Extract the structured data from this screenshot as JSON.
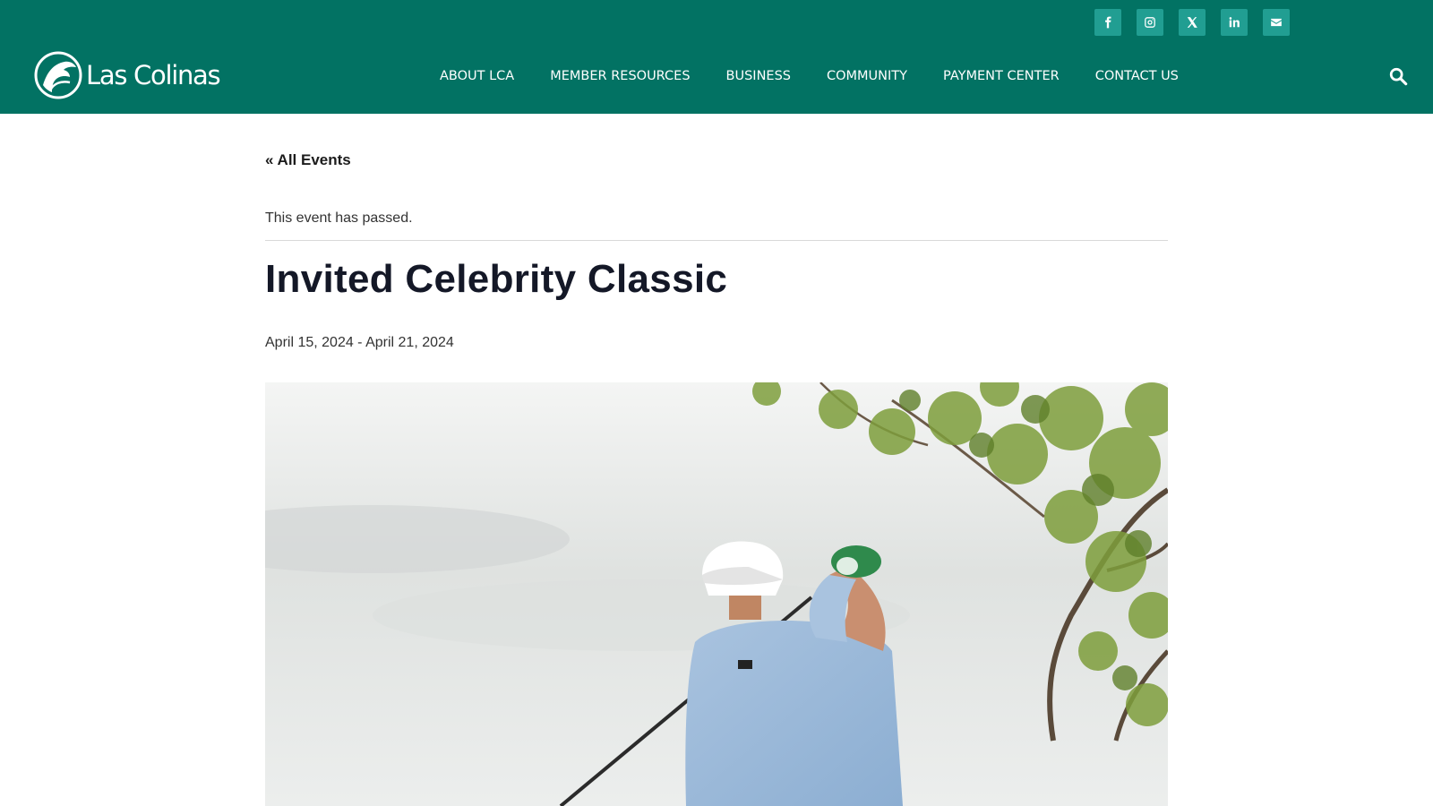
{
  "brand": {
    "name": "Las Colinas",
    "logo_icon": "horse-head-logo-icon"
  },
  "social": [
    {
      "icon": "facebook-icon",
      "label": "f"
    },
    {
      "icon": "instagram-icon",
      "label": ""
    },
    {
      "icon": "x-twitter-icon",
      "label": ""
    },
    {
      "icon": "linkedin-icon",
      "label": "in"
    },
    {
      "icon": "envelope-icon",
      "label": ""
    }
  ],
  "nav": {
    "items": [
      {
        "label": "ABOUT LCA"
      },
      {
        "label": "MEMBER RESOURCES"
      },
      {
        "label": "BUSINESS"
      },
      {
        "label": "COMMUNITY"
      },
      {
        "label": "PAYMENT CENTER"
      },
      {
        "label": "CONTACT US"
      }
    ],
    "search_icon": "search-icon"
  },
  "event": {
    "back_label": "« All Events",
    "notice": "This event has passed.",
    "title": "Invited Celebrity Classic",
    "dates": "April 15, 2024 - April 21, 2024",
    "image_subject": "golfer-photo"
  },
  "colors": {
    "header_bg": "#027263",
    "social_bg": "#219e92",
    "title": "#141827"
  }
}
